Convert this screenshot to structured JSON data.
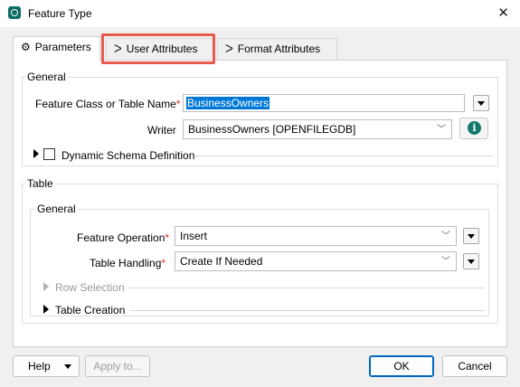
{
  "window": {
    "title": "Feature Type",
    "app_icon": "fme-icon",
    "close_glyph": "✕"
  },
  "tabs": [
    {
      "label": "Parameters",
      "icon": "gear-icon",
      "active": true
    },
    {
      "label": "User Attributes",
      "icon": "attribute-icon",
      "active": false,
      "highlighted": true
    },
    {
      "label": "Format Attributes",
      "icon": "attribute-icon",
      "active": false
    }
  ],
  "general": {
    "legend": "General",
    "feature_class_label": "Feature Class or Table Name",
    "feature_class_value": "BusinessOwners",
    "writer_label": "Writer",
    "writer_value": "BusinessOwners [OPENFILEGDB]",
    "dynamic_schema_label": "Dynamic Schema Definition",
    "dynamic_schema_checked": false
  },
  "table": {
    "legend": "Table",
    "sub_legend": "General",
    "feature_operation_label": "Feature Operation",
    "feature_operation_value": "Insert",
    "table_handling_label": "Table Handling",
    "table_handling_value": "Create If Needed",
    "row_selection_label": "Row Selection",
    "table_creation_label": "Table Creation"
  },
  "required_marker": "*",
  "footer": {
    "help": "Help",
    "apply": "Apply to...",
    "ok": "OK",
    "cancel": "Cancel"
  },
  "colors": {
    "highlight": "#e8594f",
    "selection": "#0078d7",
    "info": "#127a6c",
    "required": "#d93025"
  }
}
